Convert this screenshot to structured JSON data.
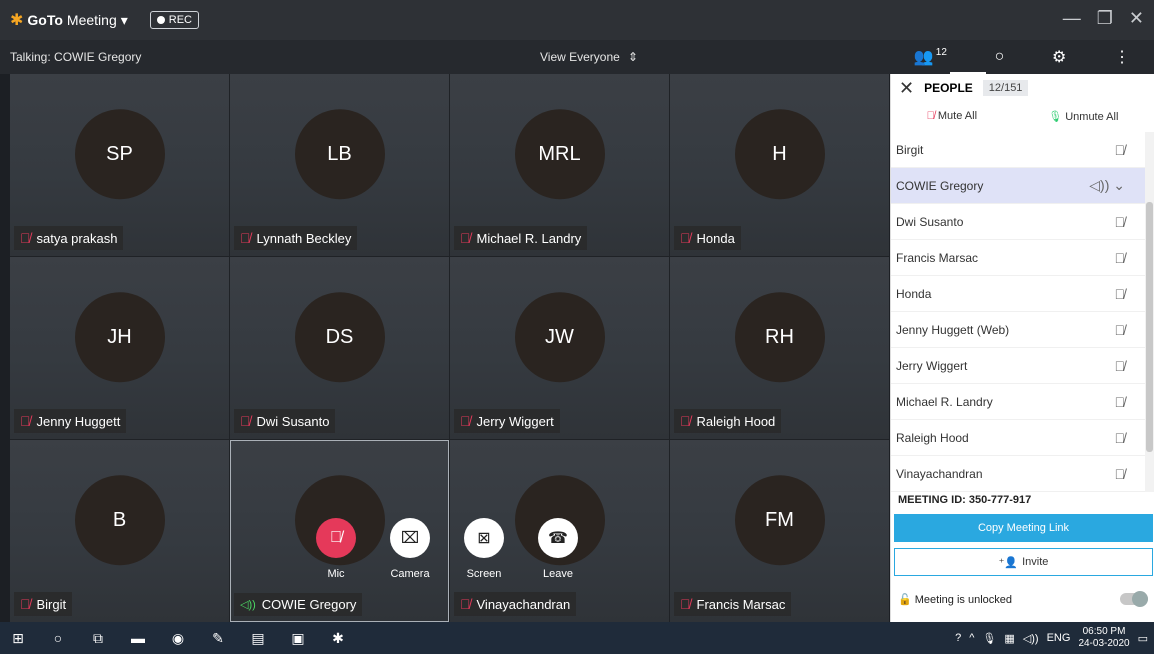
{
  "titlebar": {
    "brand_bold": "GoTo",
    "brand_rest": "Meeting",
    "rec_label": "REC"
  },
  "infobar": {
    "talking": "Talking: COWIE Gregory",
    "view": "View Everyone"
  },
  "topright": {
    "people_count": "12"
  },
  "tiles": [
    {
      "initials": "SP",
      "name": "satya prakash",
      "state": "muted"
    },
    {
      "initials": "LB",
      "name": "Lynnath Beckley",
      "state": "muted"
    },
    {
      "initials": "MRL",
      "name": "Michael R. Landry",
      "state": "muted"
    },
    {
      "initials": "H",
      "name": "Honda",
      "state": "muted"
    },
    {
      "initials": "JH",
      "name": "Jenny Huggett",
      "state": "muted"
    },
    {
      "initials": "DS",
      "name": "Dwi Susanto",
      "state": "muted"
    },
    {
      "initials": "JW",
      "name": "Jerry Wiggert",
      "state": "muted"
    },
    {
      "initials": "RH",
      "name": "Raleigh Hood",
      "state": "muted"
    },
    {
      "initials": "B",
      "name": "Birgit",
      "state": "muted"
    },
    {
      "initials": "",
      "name": "COWIE Gregory",
      "state": "speaking"
    },
    {
      "initials": "",
      "name": "Vinayachandran",
      "state": "muted"
    },
    {
      "initials": "FM",
      "name": "Francis Marsac",
      "state": "muted"
    }
  ],
  "controls": {
    "mic": "Mic",
    "camera": "Camera",
    "screen": "Screen",
    "leave": "Leave"
  },
  "panel": {
    "title": "PEOPLE",
    "count": "12/151",
    "mute_all": "Mute All",
    "unmute_all": "Unmute All",
    "people": [
      {
        "name": "Birgit"
      },
      {
        "name": "COWIE Gregory",
        "selected": true
      },
      {
        "name": "Dwi Susanto"
      },
      {
        "name": "Francis Marsac"
      },
      {
        "name": "Honda"
      },
      {
        "name": "Jenny Huggett  (Web)"
      },
      {
        "name": "Jerry Wiggert"
      },
      {
        "name": "Michael R. Landry"
      },
      {
        "name": "Raleigh Hood"
      },
      {
        "name": "Vinayachandran"
      }
    ],
    "meeting_id": "MEETING ID:  350-777-917",
    "copy_link": "Copy Meeting Link",
    "invite": "Invite",
    "unlock": "Meeting is unlocked"
  },
  "taskbar": {
    "lang": "ENG",
    "time": "06:50 PM",
    "date": "24-03-2020"
  },
  "colors": {
    "accent": "#2aa8e0",
    "muted": "#e5395a",
    "speaking": "#4cd964"
  }
}
